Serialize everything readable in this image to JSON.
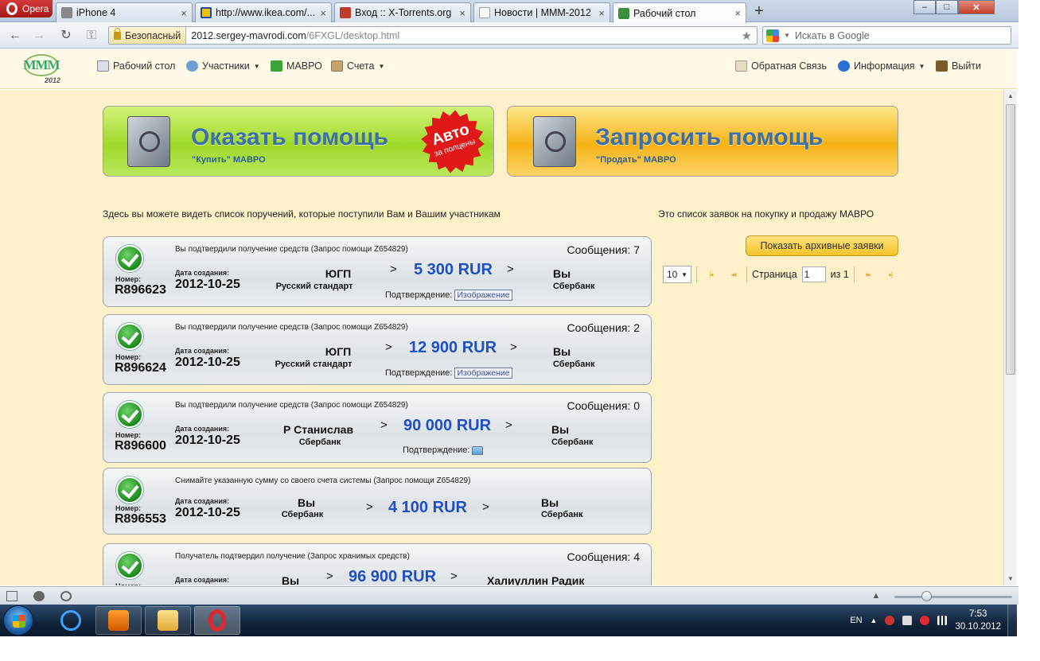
{
  "browser": {
    "menu_label": "Opera",
    "tabs": [
      {
        "label": "iPhone 4",
        "favicon_color": "#888888"
      },
      {
        "label": "http://www.ikea.com/...",
        "favicon_color": "#f2c000"
      },
      {
        "label": "Вход :: X-Torrents.org",
        "favicon_color": "#c0392b"
      },
      {
        "label": "Новости | МММ-2012 ...",
        "favicon_color": "#dddddd"
      },
      {
        "label": "Рабочий стол",
        "favicon_color": "#3a8f3a"
      }
    ],
    "new_tab_symbol": "+",
    "security_label": "Безопасный",
    "url_domain": "2012.sergey-mavrodi.com",
    "url_path": "/6FXGL/desktop.html",
    "search_placeholder": "Искать в Google"
  },
  "site": {
    "logo_text": "МММ",
    "logo_year": "2012",
    "nav": {
      "desktop": "Рабочий стол",
      "participants": "Участники",
      "mavro": "МАВРО",
      "accounts": "Счета",
      "feedback": "Обратная Связь",
      "info": "Информация",
      "logout": "Выйти"
    }
  },
  "actions": {
    "give_title": "Оказать помощь",
    "give_sub": "\"Купить\" МАВРО",
    "auto_badge_big": "Авто",
    "auto_badge_small": "за полцены",
    "ask_title": "Запросить помощь",
    "ask_sub": "\"Продать\" МАВРО"
  },
  "orders_desc": "Здесь вы можете видеть список поручений, которые поступили Вам и Вашим участникам",
  "requests_desc": "Это список заявок на покупку и продажу МАВРО",
  "archive_button": "Показать архивные заявки",
  "pager": {
    "page_size": "10",
    "page_label": "Страница",
    "page_value": "1",
    "of_label": "из 1"
  },
  "labels": {
    "number": "Номер:",
    "created": "Дата создания:",
    "confirmation": "Подтверждение:",
    "image": "Изображение",
    "arrow": ">"
  },
  "orders": [
    {
      "status": "Вы подтвердили получение средств (Запрос помощи Z654829)",
      "messages": "Сообщения: 7",
      "number": "R896623",
      "date": "2012-10-25",
      "from": "ЮГП",
      "from_bank": "Русский стандарт",
      "amount": "5 300 RUR",
      "to": "Вы",
      "to_bank": "Сбербанк"
    },
    {
      "status": "Вы подтвердили получение средств (Запрос помощи Z654829)",
      "messages": "Сообщения: 2",
      "number": "R896624",
      "date": "2012-10-25",
      "from": "ЮГП",
      "from_bank": "Русский стандарт",
      "amount": "12 900 RUR",
      "to": "Вы",
      "to_bank": "Сбербанк"
    },
    {
      "status": "Вы подтвердили получение средств (Запрос помощи Z654829)",
      "messages": "Сообщения: 0",
      "number": "R896600",
      "date": "2012-10-25",
      "from": "Р Станислав",
      "from_bank": "Сбербанк",
      "amount": "90 000 RUR",
      "to": "Вы",
      "to_bank": "Сбербанк"
    },
    {
      "status": "Снимайте указанную сумму со своего счета системы (Запрос помощи Z654829)",
      "messages": "",
      "number": "R896553",
      "date": "2012-10-25",
      "from": "Вы",
      "from_bank": "Сбербанк",
      "amount": "4 100 RUR",
      "to": "Вы",
      "to_bank": "Сбербанк"
    },
    {
      "status": "Получатель подтвердил получение (Запрос хранимых средств)",
      "messages": "Сообщения: 4",
      "number": "",
      "date": "",
      "from": "Вы",
      "from_bank": "",
      "amount": "96 900 RUR",
      "to": "Халиуллин Радик",
      "to_bank": ""
    }
  ],
  "taskbar": {
    "lang": "EN",
    "time": "7:53",
    "date": "30.10.2012"
  },
  "colors": {
    "page_bg": "#fdf1c9",
    "amount": "#1e4fc4",
    "give_green": "#9fd92a",
    "ask_orange": "#f6b316",
    "opera_red": "#c0392b"
  },
  "icons": {
    "tab_close": "×",
    "back": "←",
    "forward": "→",
    "reload": "↻",
    "key": "⚿",
    "star": "★",
    "caret": "▼",
    "first": "|◂",
    "prev": "◂◂",
    "next": "▸▸",
    "last": "▸|",
    "scroll_up": "▲",
    "scroll_down": "▼",
    "minimize": "–",
    "maximize": "□",
    "close": "✕",
    "tray_up": "▲"
  }
}
